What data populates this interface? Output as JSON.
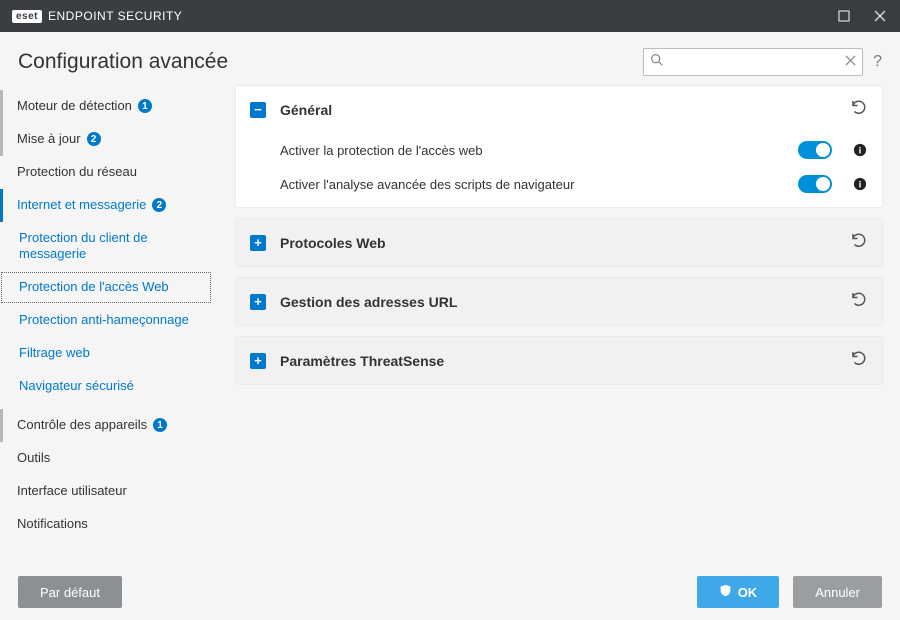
{
  "titlebar": {
    "brand_tag": "eset",
    "brand_text": "ENDPOINT SECURITY"
  },
  "header": {
    "title": "Configuration avancée",
    "search_placeholder": ""
  },
  "sidebar": {
    "items": [
      {
        "label": "Moteur de détection",
        "badge": "1"
      },
      {
        "label": "Mise à jour",
        "badge": "2"
      },
      {
        "label": "Protection du réseau"
      },
      {
        "label": "Internet et messagerie",
        "badge": "2"
      },
      {
        "label": "Contrôle des appareils",
        "badge": "1"
      },
      {
        "label": "Outils"
      },
      {
        "label": "Interface utilisateur"
      },
      {
        "label": "Notifications"
      }
    ],
    "subitems": [
      {
        "label": "Protection du client de messagerie"
      },
      {
        "label": "Protection de l'accès Web"
      },
      {
        "label": "Protection anti-hameçonnage"
      },
      {
        "label": "Filtrage web"
      },
      {
        "label": "Navigateur sécurisé"
      }
    ]
  },
  "panels": {
    "general": {
      "title": "Général",
      "row1": "Activer la protection de l'accès web",
      "row2": "Activer l'analyse avancée des scripts de navigateur"
    },
    "protocols": {
      "title": "Protocoles Web"
    },
    "urlmgmt": {
      "title": "Gestion des adresses URL"
    },
    "threatsense": {
      "title": "Paramètres ThreatSense"
    }
  },
  "footer": {
    "default": "Par défaut",
    "ok": "OK",
    "cancel": "Annuler"
  }
}
